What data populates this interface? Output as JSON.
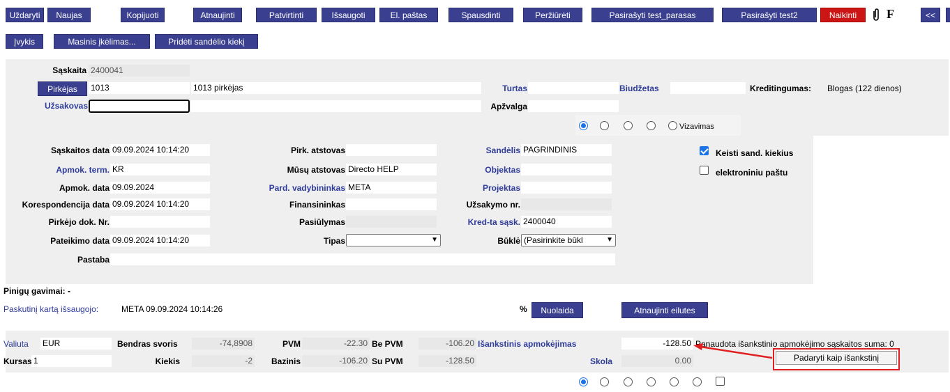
{
  "toolbar": {
    "row1": [
      "Uždaryti",
      "Naujas",
      "Kopijuoti",
      "Atnaujinti",
      "Patvirtinti",
      "Išsaugoti",
      "El. paštas",
      "Spausdinti",
      "Peržiūrėti",
      "Pasirašyti test_parasas",
      "Pasirašyti test2",
      "Naikinti"
    ],
    "attach_icon": "paperclip-icon",
    "f_label": "F",
    "collapse_label": "<<",
    "row2": [
      "Įvykis",
      "Masinis įkėlimas...",
      "Pridėti sandėlio kiekį"
    ]
  },
  "header": {
    "saskaita_label": "Sąskaita",
    "saskaita_value": "2400041",
    "pirkejas_label": "Pirkėjas",
    "pirkejas_code": "1013",
    "pirkejas_name": "1013 pirkėjas",
    "turtas_label": "Turtas",
    "biudzetas_label": "Biudžetas",
    "kreditingumas_label": "Kreditingumas:",
    "kreditingumas_value": "Blogas (122 dienos)",
    "uzsakovas_label": "Užsakovas",
    "apzvalga_label": "Apžvalga",
    "vizavimas_label": "Vizavimas"
  },
  "details": {
    "saskaitos_data_label": "Sąskaitos data",
    "saskaitos_data": "09.09.2024 10:14:20",
    "apmok_term_label": "Apmok. term.",
    "apmok_term": "KR",
    "apmok_data_label": "Apmok. data",
    "apmok_data": "09.09.2024",
    "korespondencija_label": "Korespondencija data",
    "korespondencija_data": "09.09.2024 10:14:20",
    "pirkejo_dok_label": "Pirkėjo dok. Nr.",
    "pateikimo_label": "Pateikimo data",
    "pateikimo_data": "09.09.2024 10:14:20",
    "pastaba_label": "Pastaba",
    "pirk_atstovas_label": "Pirk. atstovas",
    "musu_atstovas_label": "Mūsų atstovas",
    "musu_atstovas": "Directo HELP",
    "pard_vadybininkas_label": "Pard. vadybininkas",
    "pard_vadybininkas": "META",
    "finansininkas_label": "Finansininkas",
    "pasiulymas_label": "Pasiūlymas",
    "tipas_label": "Tipas",
    "sandelis_label": "Sandėlis",
    "sandelis": "PAGRINDINIS",
    "objektas_label": "Objektas",
    "projektas_label": "Projektas",
    "uzsakymo_label": "Užsakymo nr.",
    "kredta_label": "Kred-ta sąsk.",
    "kredta": "2400040",
    "bukle_label": "Būklė",
    "bukle": "(Pasirinkite būkl",
    "keisti_label": "Keisti sand. kiekius",
    "elektroniniu_label": "elektroniniu paštu"
  },
  "middle": {
    "pinigu_label": "Pinigų gavimai: -",
    "paskutini_label": "Paskutinį kartą išsaugojo:",
    "paskutini_value": "META 09.09.2024 10:14:26",
    "percent": "%",
    "nuolaida": "Nuolaida",
    "atnaujinti_eilutes": "Atnaujinti eilutes"
  },
  "totals": {
    "valiuta_label": "Valiuta",
    "valiuta": "EUR",
    "kursas_label": "Kursas",
    "kursas": "1",
    "bendras_svoris_label": "Bendras svoris",
    "bendras_svoris": "-74,8908",
    "kiekis_label": "Kiekis",
    "kiekis": "-2",
    "pvm_label": "PVM",
    "pvm": "-22.30",
    "bazinis_label": "Bazinis",
    "bazinis": "-106.20",
    "be_pvm_label": "Be PVM",
    "be_pvm": "-106.20",
    "su_pvm_label": "Su PVM",
    "su_pvm": "-128.50",
    "isankstinis_label": "Išankstinis apmokėjimas",
    "isankstinis": "-128.50",
    "panaudota_label": "Panaudota išankstinio apmokėjimo sąskaitos suma: 0",
    "skola_label": "Skola",
    "skola": "0.00",
    "padaryti_button": "Padaryti kaip išankstinį"
  },
  "colors": {
    "toolbar": "#3a3f8f",
    "delete": "#cc1616",
    "link": "#2f3c9a",
    "panel": "#efefef",
    "annotation": "#e02020"
  }
}
